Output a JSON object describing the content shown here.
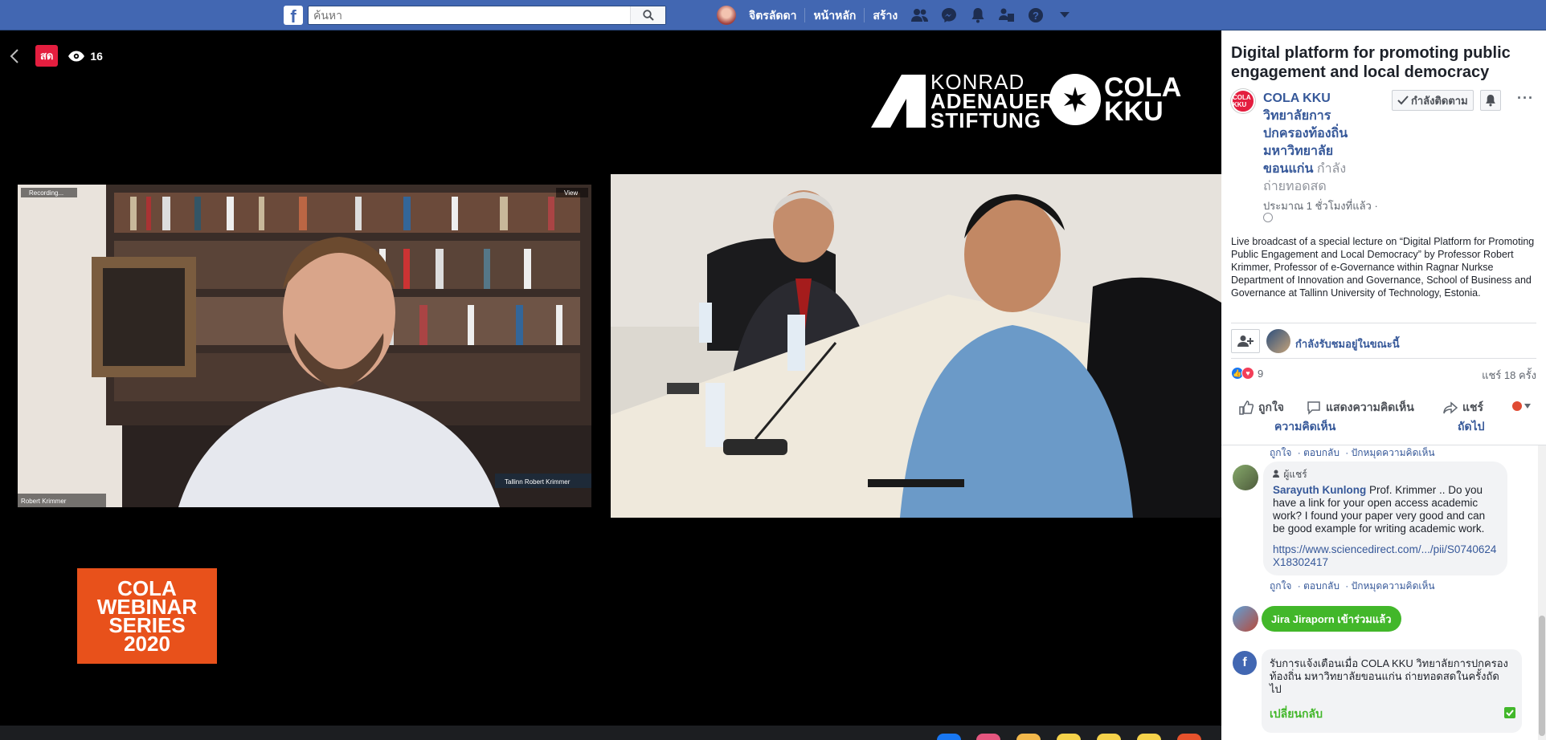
{
  "topbar": {
    "search_placeholder": "ค้นหา",
    "user_name": "จิตรลัดดา",
    "home_label": "หน้าหลัก",
    "create_label": "สร้าง"
  },
  "video": {
    "live_label": "สด",
    "viewer_count": "16",
    "kas_lines": [
      "KONRAD",
      "ADENAUER",
      "STIFTUNG"
    ],
    "cola_lines": [
      "COLA",
      "KKU"
    ],
    "zoom_recording_label": "Recording...",
    "zoom_view_label": "View",
    "zoom_name_left": "Robert Krimmer",
    "zoom_name_tag": "Tallinn Robert Krimmer",
    "webinar_lines": [
      "COLA",
      "WEBINAR",
      "SERIES",
      "2020"
    ]
  },
  "post": {
    "title": "Digital platform for promoting public engagement and local democracy",
    "page_avatar_text": "COLA KKU",
    "page_name_lines": [
      "COLA KKU",
      "วิทยาลัยการ",
      "ปกครองท้องถิ่น",
      "มหาวิทยาลัย",
      "ขอนแก่น"
    ],
    "live_status": "กำลัง",
    "live_status_2": "ถ่ายทอดสด",
    "time_ago": "ประมาณ 1 ชั่วโมงที่แล้ว ·",
    "follow_label": "กำลังติดตาม",
    "description": "Live broadcast of a special lecture on “Digital Platform for Promoting Public Engagement and Local Democracy” by Professor Robert Krimmer, Professor of e-Governance within Ragnar Nurkse Department of Innovation and Governance, School of Business and Governance at Tallinn University of Technology, Estonia.",
    "viewers_now": "กำลังรับชมอยู่ในขณะนี้",
    "reaction_count": "9",
    "share_count": "แชร์ 18 ครั้ง",
    "actions": {
      "like": "ถูกใจ",
      "comment": "แสดงความคิดเห็น",
      "share": "แชร์",
      "comment_wrap": "ความคิดเห็น",
      "next": "ถัดไป"
    }
  },
  "comments": {
    "top_actions": [
      "ถูกใจ",
      "· ตอบกลับ",
      "· ปักหมุดความคิดเห็น"
    ],
    "share_badge": "ผู้แชร์",
    "c1_author": "Sarayuth Kunlong",
    "c1_text": "Prof. Krimmer .. Do you have a link for your open access academic work? I found your paper very good and can be good example for writing academic work.",
    "c1_link": "https://www.sciencedirect.com/.../pii/S0740624X18302417",
    "c1_actions": [
      "ถูกใจ",
      "· ตอบกลับ",
      "· ปักหมุดความคิดเห็น"
    ],
    "join_text": "Jira Jiraporn เข้าร่วมแล้ว",
    "notif_text": "รับการแจ้งเตือนเมื่อ COLA KKU วิทยาลัยการปกครองท้องถิ่น มหาวิทยาลัยขอนแก่น ถ่ายทอดสดในครั้งถัดไป",
    "notif_action": "เปลี่ยนกลับ"
  }
}
